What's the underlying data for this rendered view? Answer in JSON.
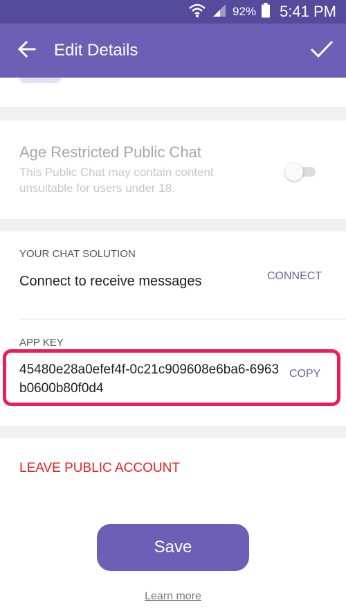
{
  "status_bar": {
    "battery": "92%",
    "time": "5:41 PM"
  },
  "app_bar": {
    "title": "Edit Details",
    "back_icon": "arrow-left-icon",
    "confirm_icon": "check-icon"
  },
  "age_restricted": {
    "title": "Age Restricted Public Chat",
    "description": "This Public Chat may contain content unsuitable for users under 18.",
    "enabled": false,
    "disabled_style": true
  },
  "chat_solution": {
    "label": "YOUR CHAT SOLUTION",
    "text": "Connect to receive messages",
    "connect_label": "CONNECT"
  },
  "app_key": {
    "label": "APP KEY",
    "value": "45480e28a0efef4f-0c21c909608e6ba6-6963b0600b80f0d4",
    "copy_label": "COPY"
  },
  "leave_label": "LEAVE PUBLIC ACCOUNT",
  "save_label": "Save",
  "learn_more_label": "Learn more",
  "colors": {
    "status_bar": "#564a9c",
    "app_bar": "#6c5fb5",
    "accent": "#6c5fb5",
    "danger": "#e8201e",
    "highlight": "#ee1a5c"
  }
}
